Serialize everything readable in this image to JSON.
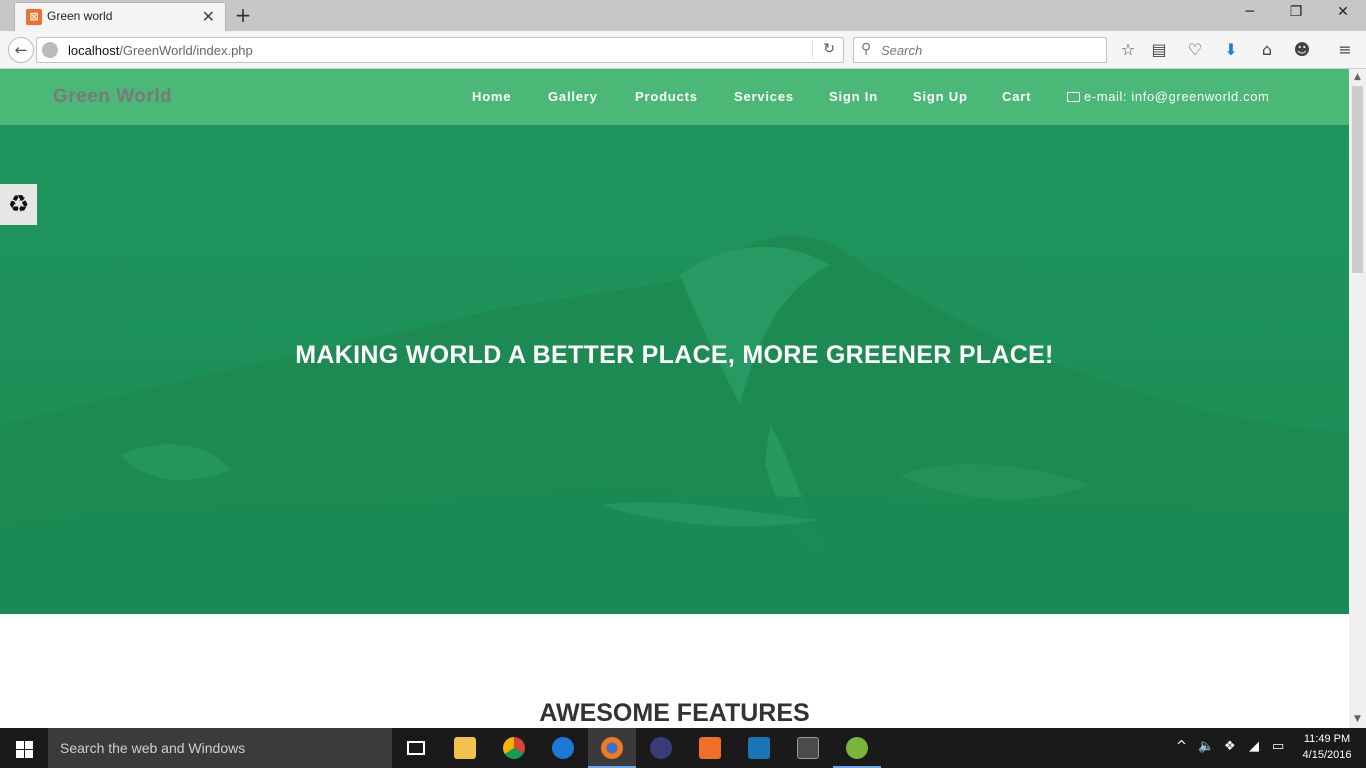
{
  "browser": {
    "tab_title": "Green world",
    "url_host": "localhost",
    "url_path": "/GreenWorld/index.php",
    "search_placeholder": "Search"
  },
  "site": {
    "brand": "Green World",
    "nav": [
      "Home",
      "Gallery",
      "Products",
      "Services",
      "Sign In",
      "Sign Up",
      "Cart"
    ],
    "email": "e-mail: info@greenworld.com",
    "hero_title": "MAKING WORLD A BETTER PLACE, MORE GREENER PLACE!",
    "features_title": "AWESOME FEATURES",
    "side_widget_icon": "recycle-icon"
  },
  "taskbar": {
    "search_text": "Search the web and Windows",
    "time": "11:49 PM",
    "date": "4/15/2016"
  },
  "colors": {
    "nav_green": "#4cb877",
    "hero_green": "#1f925a"
  }
}
